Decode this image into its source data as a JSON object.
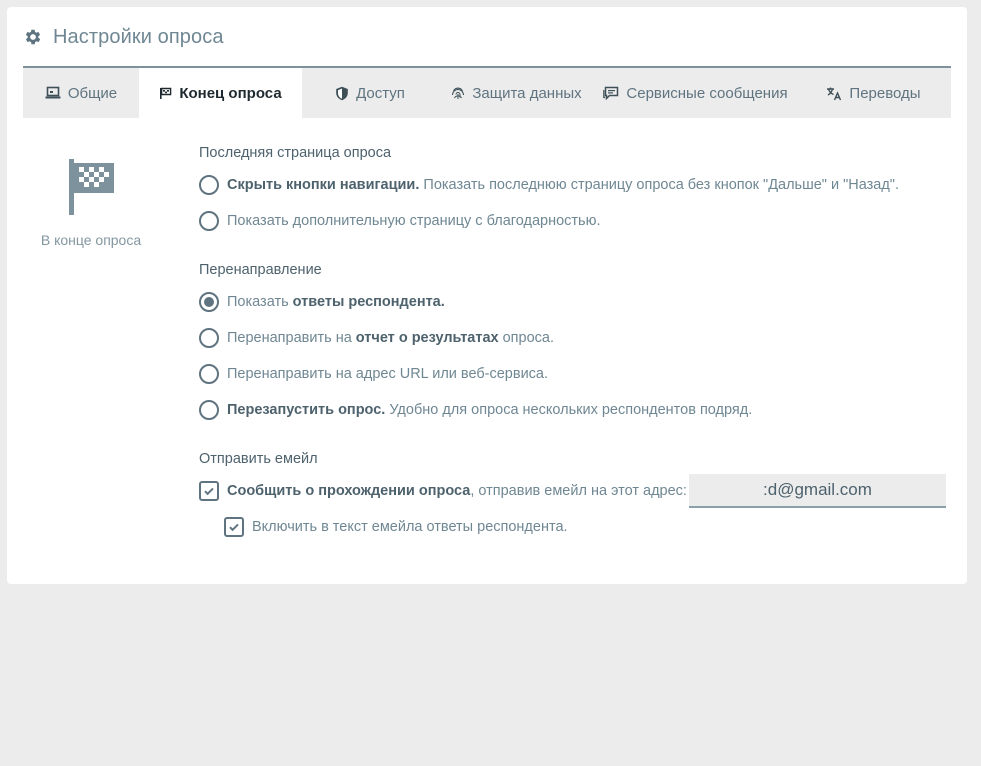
{
  "header": {
    "title": "Настройки опроса",
    "icon": "gear-icon"
  },
  "tabs": [
    {
      "label": "Общие",
      "icon": "laptop-icon",
      "active": false
    },
    {
      "label": "Конец опроса",
      "icon": "flag-icon",
      "active": true
    },
    {
      "label": "Доступ",
      "icon": "shield-icon",
      "active": false
    },
    {
      "label": "Защита данных",
      "icon": "fingerprint-icon",
      "active": false
    },
    {
      "label": "Сервисные сообщения",
      "icon": "messages-icon",
      "active": false
    },
    {
      "label": "Переводы",
      "icon": "translate-icon",
      "active": false
    }
  ],
  "side": {
    "caption": "В конце опроса",
    "icon": "checkered-flag-icon"
  },
  "sections": {
    "last_page": {
      "title": "Последняя страница опроса",
      "options": [
        {
          "bold": "Скрыть кнопки навигации.",
          "text": " Показать последнюю страницу опроса без кнопок \"Дальше\" и \"Назад\".",
          "selected": false
        },
        {
          "text": "Показать дополнительную страницу с благодарностью.",
          "selected": false
        }
      ]
    },
    "redirect": {
      "title": "Перенаправление",
      "options": [
        {
          "pre": "Показать ",
          "bold": "ответы респондента.",
          "selected": true
        },
        {
          "pre": "Перенаправить на ",
          "bold": "отчет о результатах",
          "post": " опроса.",
          "selected": false
        },
        {
          "pre": "Перенаправить на адрес URL или веб-сервиса.",
          "selected": false
        },
        {
          "bold": "Перезапустить опрос.",
          "post": " Удобно для опроса нескольких респондентов подряд.",
          "selected": false
        }
      ]
    },
    "email": {
      "title": "Отправить емейл",
      "notify_bold": "Сообщить о прохождении опроса",
      "notify_text": ", отправив емейл на этот адрес:",
      "notify_checked": true,
      "email_value": ":d@gmail.com",
      "include_label": "Включить в текст емейла ответы респондента.",
      "include_checked": true
    }
  },
  "colors": {
    "accent": "#5f7480",
    "background": "#ececec",
    "card": "#ffffff"
  }
}
